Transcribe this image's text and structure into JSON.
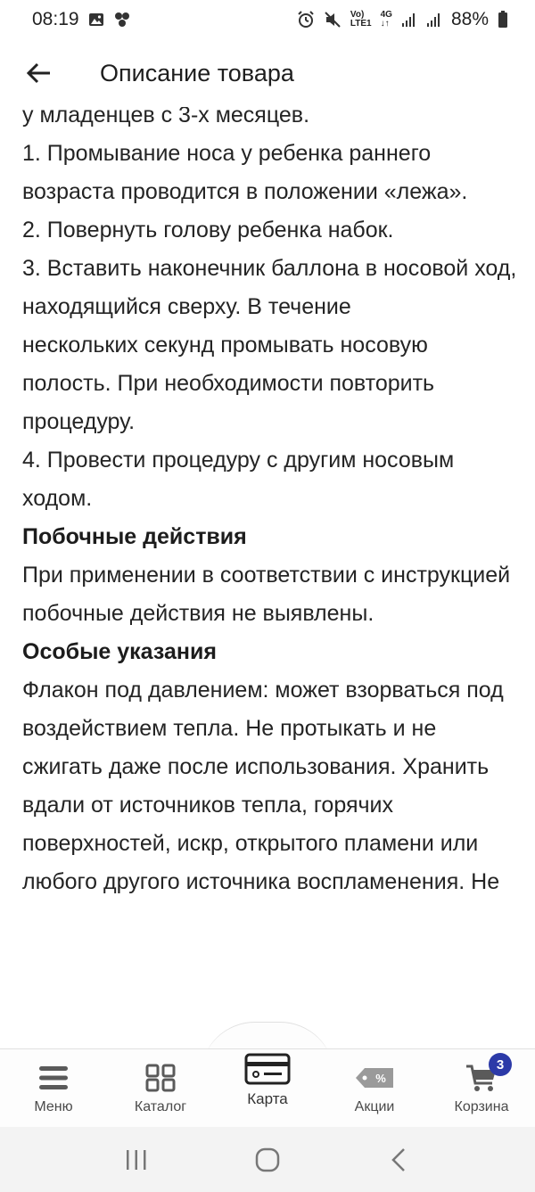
{
  "status_bar": {
    "time": "08:19",
    "net_top": "Vo)",
    "net_bottom": "LTE1",
    "net_type": "4G",
    "battery": "88%"
  },
  "header": {
    "title": "Описание товара"
  },
  "content": [
    {
      "type": "p",
      "text": "у младенцев с 3-х месяцев."
    },
    {
      "type": "p",
      "text": "1. Промывание носа у ребенка раннего возраста проводится в положении «лежа»."
    },
    {
      "type": "p",
      "text": "2. Повернуть голову ребенка набок."
    },
    {
      "type": "p",
      "text": "3. Вставить наконечник баллона в носовой ход, находящийся сверху. В течение"
    },
    {
      "type": "p",
      "text": "нескольких секунд промывать носовую полость. При необходимости повторить процедуру."
    },
    {
      "type": "p",
      "text": "4. Провести процедуру с другим носовым ходом."
    },
    {
      "type": "h",
      "text": "Побочные действия"
    },
    {
      "type": "p",
      "text": "При применении в соответствии с инструкцией побочные действия не выявлены."
    },
    {
      "type": "h",
      "text": "Особые указания"
    },
    {
      "type": "p",
      "text": "Флакон под давлением: может взорваться под воздействием тепла. Не протыкать и не сжигать даже после использования. Хранить вдали от источников тепла, горячих поверхностей, искр, открытого пламени или любого другого источника воспламенения. Не"
    }
  ],
  "bottom_nav": {
    "menu": "Меню",
    "catalog": "Каталог",
    "card": "Карта",
    "promo": "Акции",
    "cart": "Корзина",
    "cart_count": "3"
  },
  "colors": {
    "badge": "#2c3aa8",
    "icon_gray": "#5a5a5a"
  }
}
